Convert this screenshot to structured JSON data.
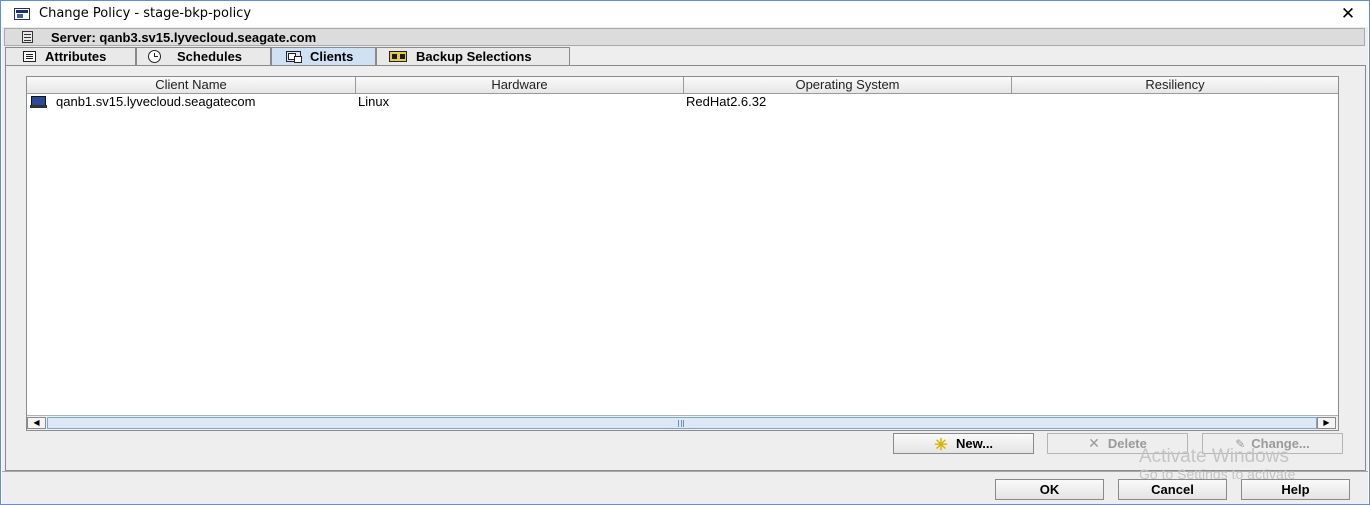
{
  "window": {
    "title": "Change Policy - stage-bkp-policy",
    "close_glyph": "✕"
  },
  "server_bar": {
    "text": "Server: qanb3.sv15.lyvecloud.seagate.com"
  },
  "tabs": [
    {
      "label": "Attributes",
      "icon": "attributes-icon",
      "active": false
    },
    {
      "label": "Schedules",
      "icon": "schedules-clock-icon",
      "active": false
    },
    {
      "label": "Clients",
      "icon": "clients-computers-icon",
      "active": true
    },
    {
      "label": "Backup Selections",
      "icon": "backup-selections-icon",
      "active": false
    }
  ],
  "table": {
    "columns": [
      "Client Name",
      "Hardware",
      "Operating System",
      "Resiliency"
    ],
    "rows": [
      {
        "client_name": "qanb1.sv15.lyvecloud.seagatecom",
        "hardware": "Linux",
        "os": "RedHat2.6.32",
        "resiliency": "",
        "icon": "client-computer-icon"
      }
    ]
  },
  "scrollbar": {
    "left_arrow": "◀",
    "right_arrow": "▶"
  },
  "actions": {
    "new_label": "New...",
    "delete_label": "Delete",
    "change_label": "Change..."
  },
  "footer": {
    "ok_label": "OK",
    "cancel_label": "Cancel",
    "help_label": "Help"
  },
  "watermark": {
    "line1": "Activate Windows",
    "line2": "Go to Settings to activate"
  }
}
